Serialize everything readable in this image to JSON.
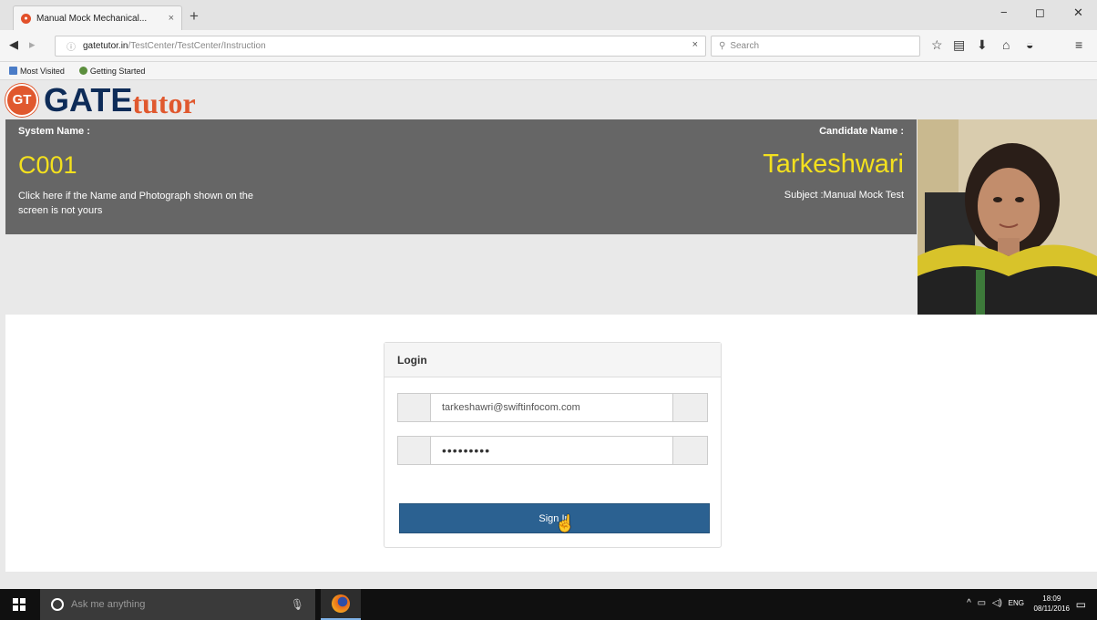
{
  "browser": {
    "tab_title": "Manual Mock Mechanical...",
    "tab_close": "×",
    "new_tab": "+",
    "url_host": "gatetutor.in",
    "url_path": "/TestCenter/TestCenter/Instruction",
    "url_clear": "×",
    "search_placeholder": "Search",
    "bookmarks": [
      "Most Visited",
      "Getting Started"
    ]
  },
  "header": {
    "logo_badge": "GT",
    "logo_gate": "GATE",
    "logo_tutor": "tutor"
  },
  "info": {
    "system_label": "System Name :",
    "system_value": "C001",
    "note": "Click here if the Name and Photograph shown on the screen is not yours",
    "candidate_label": "Candidate Name :",
    "candidate_value": "Tarkeshwari",
    "subject": "Subject :Manual Mock Test"
  },
  "login": {
    "heading": "Login",
    "email_value": "tarkeshawri@swiftinfocom.com",
    "password_value": "•••••••••",
    "signin_label": "Sign In"
  },
  "taskbar": {
    "search_placeholder": "Ask me anything",
    "lang": "ENG",
    "time": "18:09",
    "date": "08/11/2016"
  }
}
